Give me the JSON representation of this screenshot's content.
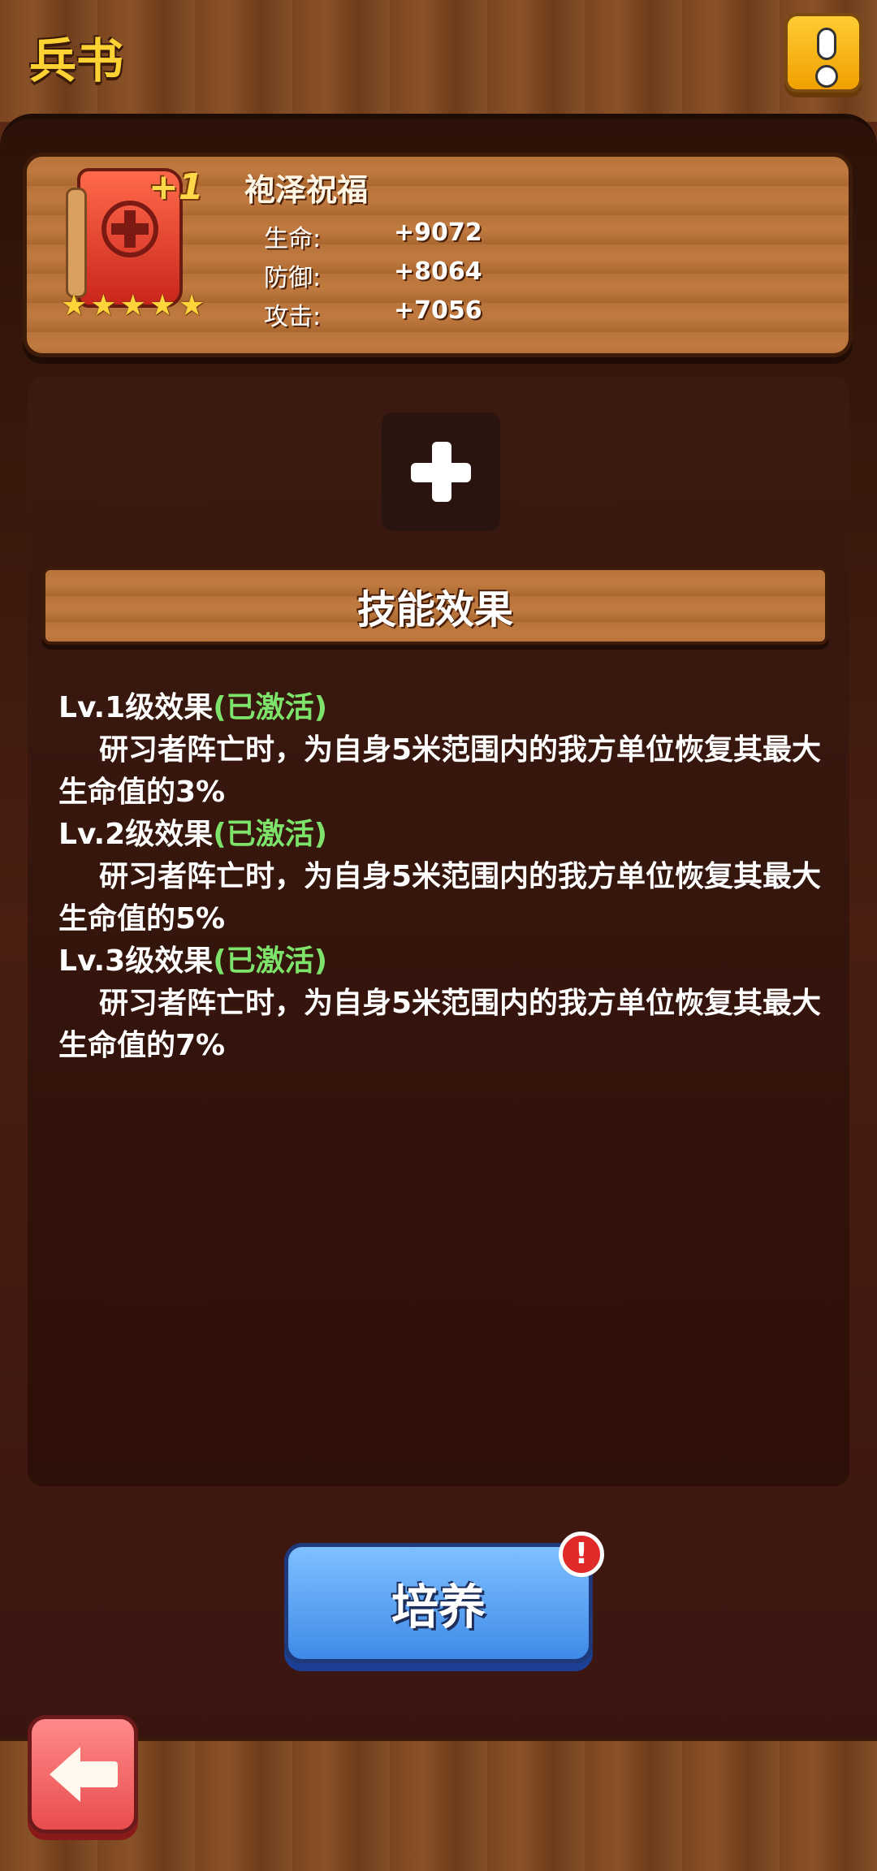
{
  "header": {
    "title": "兵书"
  },
  "item": {
    "name": "袍泽祝福",
    "level_badge": "+1",
    "stars": 5,
    "stats": [
      {
        "label": "生命:",
        "value": "+9072"
      },
      {
        "label": "防御:",
        "value": "+8064"
      },
      {
        "label": "攻击:",
        "value": "+7056"
      }
    ]
  },
  "skill": {
    "header": "技能效果",
    "effects": [
      {
        "level": "Lv.1级效果",
        "status": "(已激活)",
        "desc": "研习者阵亡时，为自身5米范围内的我方单位恢复其最大生命值的3%"
      },
      {
        "level": "Lv.2级效果",
        "status": "(已激活)",
        "desc": "研习者阵亡时，为自身5米范围内的我方单位恢复其最大生命值的5%"
      },
      {
        "level": "Lv.3级效果",
        "status": "(已激活)",
        "desc": "研习者阵亡时，为自身5米范围内的我方单位恢复其最大生命值的7%"
      }
    ]
  },
  "actions": {
    "train_label": "培养",
    "alert_mark": "!"
  },
  "colors": {
    "active": "#7ee36a",
    "title": "#ffd233",
    "train": "#4f95ef",
    "back": "#ef5b5b"
  }
}
